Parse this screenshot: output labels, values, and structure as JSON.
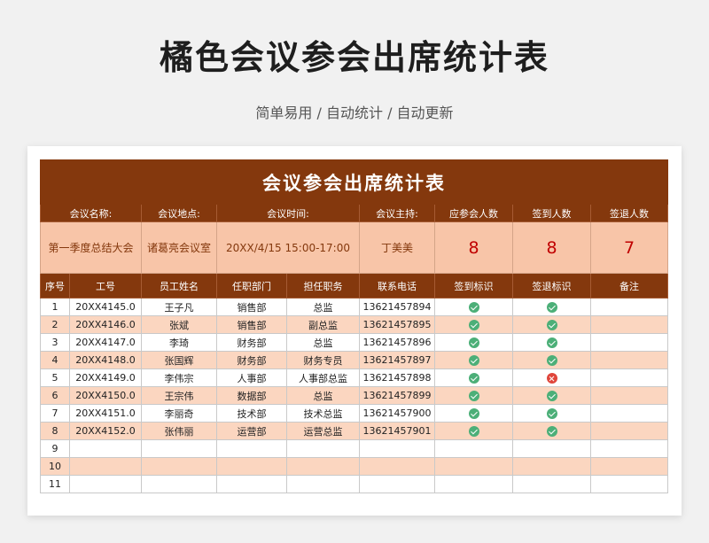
{
  "page_title": "橘色会议参会出席统计表",
  "subtitle": "简单易用 / 自动统计 / 自动更新",
  "sheet": {
    "title": "会议参会出席统计表",
    "info_headers": [
      "会议名称:",
      "会议地点:",
      "会议时间:",
      "会议主持:",
      "应参会人数",
      "签到人数",
      "签退人数"
    ],
    "info_values": {
      "name": "第一季度总结大会",
      "location": "诸葛亮会议室",
      "time": "20XX/4/15  15:00-17:00",
      "host": "丁美美",
      "expected": "8",
      "signed_in": "8",
      "signed_out": "7"
    },
    "columns": [
      "序号",
      "工号",
      "员工姓名",
      "任职部门",
      "担任职务",
      "联系电话",
      "签到标识",
      "签退标识",
      "备注"
    ],
    "rows": [
      {
        "no": "1",
        "id": "20XX4145.0",
        "name": "王子凡",
        "dept": "销售部",
        "role": "总监",
        "phone": "13621457894",
        "sign_in": "check-icon",
        "sign_out": "check-icon",
        "note": ""
      },
      {
        "no": "2",
        "id": "20XX4146.0",
        "name": "张斌",
        "dept": "销售部",
        "role": "副总监",
        "phone": "13621457895",
        "sign_in": "check-icon",
        "sign_out": "check-icon",
        "note": ""
      },
      {
        "no": "3",
        "id": "20XX4147.0",
        "name": "李琦",
        "dept": "财务部",
        "role": "总监",
        "phone": "13621457896",
        "sign_in": "check-icon",
        "sign_out": "check-icon",
        "note": ""
      },
      {
        "no": "4",
        "id": "20XX4148.0",
        "name": "张国辉",
        "dept": "财务部",
        "role": "财务专员",
        "phone": "13621457897",
        "sign_in": "check-icon",
        "sign_out": "check-icon",
        "note": ""
      },
      {
        "no": "5",
        "id": "20XX4149.0",
        "name": "李伟宗",
        "dept": "人事部",
        "role": "人事部总监",
        "phone": "13621457898",
        "sign_in": "check-icon",
        "sign_out": "cross-icon",
        "note": ""
      },
      {
        "no": "6",
        "id": "20XX4150.0",
        "name": "王宗伟",
        "dept": "数据部",
        "role": "总监",
        "phone": "13621457899",
        "sign_in": "check-icon",
        "sign_out": "check-icon",
        "note": ""
      },
      {
        "no": "7",
        "id": "20XX4151.0",
        "name": "李丽奇",
        "dept": "技术部",
        "role": "技术总监",
        "phone": "13621457900",
        "sign_in": "check-icon",
        "sign_out": "check-icon",
        "note": ""
      },
      {
        "no": "8",
        "id": "20XX4152.0",
        "name": "张伟丽",
        "dept": "运营部",
        "role": "运营总监",
        "phone": "13621457901",
        "sign_in": "check-icon",
        "sign_out": "check-icon",
        "note": ""
      },
      {
        "no": "9",
        "id": "",
        "name": "",
        "dept": "",
        "role": "",
        "phone": "",
        "sign_in": "",
        "sign_out": "",
        "note": ""
      },
      {
        "no": "10",
        "id": "",
        "name": "",
        "dept": "",
        "role": "",
        "phone": "",
        "sign_in": "",
        "sign_out": "",
        "note": ""
      },
      {
        "no": "11",
        "id": "",
        "name": "",
        "dept": "",
        "role": "",
        "phone": "",
        "sign_in": "",
        "sign_out": "",
        "note": ""
      }
    ]
  },
  "colors": {
    "header_bg": "#84380d",
    "info_bg": "#f8c5a8",
    "stripe_bg": "#fbd6c0",
    "count_text": "#c00000",
    "check_green": "#4caf78",
    "cross_red": "#e0463b"
  }
}
